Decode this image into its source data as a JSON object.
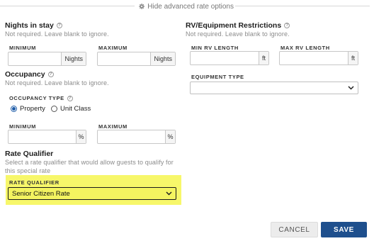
{
  "advanced_toggle": {
    "label": "Hide advanced rate options",
    "icon": "gear-icon"
  },
  "nights": {
    "title": "Nights in stay",
    "hint": "Not required. Leave blank to ignore.",
    "min_label": "MINIMUM",
    "max_label": "MAXIMUM",
    "min_value": "",
    "max_value": "",
    "unit": "Nights"
  },
  "rv": {
    "title": "RV/Equipment Restrictions",
    "hint": "Not required. Leave blank to ignore.",
    "min_label": "MIN RV LENGTH",
    "max_label": "MAX RV LENGTH",
    "min_value": "",
    "max_value": "",
    "unit": "ft",
    "equipment_label": "EQUIPMENT TYPE",
    "equipment_value": ""
  },
  "occupancy": {
    "title": "Occupancy",
    "hint": "Not required. Leave blank to ignore.",
    "type_label": "OCCUPANCY TYPE",
    "options": [
      "Property",
      "Unit Class"
    ],
    "selected": "Property",
    "min_label": "MINIMUM",
    "max_label": "MAXIMUM",
    "min_value": "",
    "max_value": "",
    "unit": "%"
  },
  "rate_qualifier": {
    "title": "Rate Qualifier",
    "hint": "Select a rate qualifier that would allow guests to qualify for this special rate",
    "field_label": "RATE QUALIFIER",
    "selected": "Senior Citizen Rate",
    "highlight_color": "#f7f76a"
  },
  "actions": {
    "cancel": "CANCEL",
    "save": "SAVE",
    "save_color": "#1e4f8d"
  }
}
